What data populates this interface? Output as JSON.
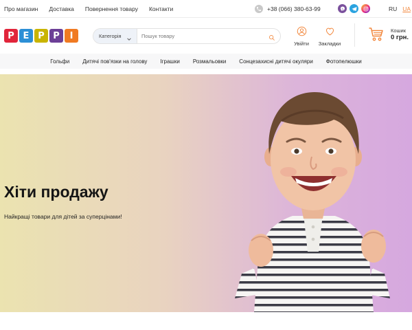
{
  "topbar": {
    "links": [
      "Про магазин",
      "Доставка",
      "Повернення товару",
      "Контакти"
    ],
    "phone": "+38 (066) 380-63-99",
    "languages": {
      "ru": "RU",
      "ua": "UA",
      "active": "UA"
    }
  },
  "header": {
    "logo": [
      {
        "letter": "P",
        "color": "#e1253b"
      },
      {
        "letter": "E",
        "color": "#2c8fd6"
      },
      {
        "letter": "P",
        "color": "#c9b400"
      },
      {
        "letter": "P",
        "color": "#6c3f97"
      },
      {
        "letter": "I",
        "color": "#f07a22"
      }
    ],
    "search": {
      "category_label": "Категорія",
      "placeholder": "Пошук товару"
    },
    "login_label": "Увійти",
    "bookmarks_label": "Закладки",
    "cart": {
      "label": "Кошик",
      "amount": "0 грн."
    },
    "accent_color": "#f2873c"
  },
  "categories": [
    "Гольфи",
    "Дитячі пов'язки на голову",
    "Іграшки",
    "Розмальовки",
    "Сонцезахисні дитячі окуляри",
    "Фотопелюшки"
  ],
  "hero": {
    "title": "Хіти продажу",
    "subtitle": "Найкращі товари для дітей за суперцінами!"
  }
}
